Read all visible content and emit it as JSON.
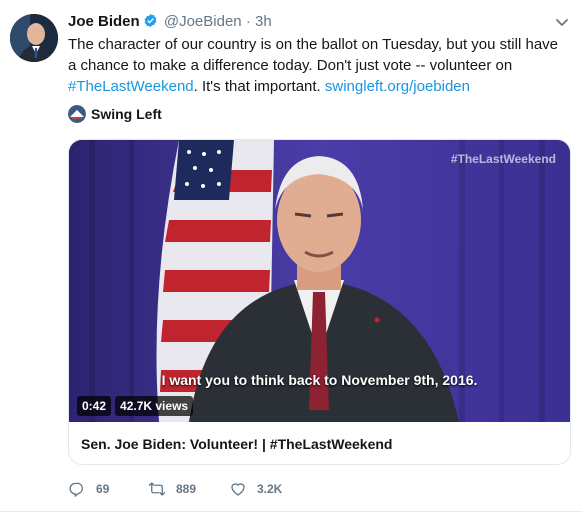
{
  "tweet": {
    "author_name": "Joe Biden",
    "handle": "@JoeBiden",
    "separator": "·",
    "time": "3h",
    "text_part1": "The character of our country is on the ballot on Tuesday, but you still have a chance to make a difference today. Don't just vote -- volunteer on ",
    "hashtag": "#TheLastWeekend",
    "text_part2": ". It's that important. ",
    "link": "swingleft.org/joebiden"
  },
  "source": {
    "name": "Swing Left"
  },
  "video": {
    "hashtag_overlay": "#TheLastWeekend",
    "subtitle": "I want you to think back to November 9th, 2016.",
    "duration": "0:42",
    "views": "42.7K views"
  },
  "card": {
    "title": "Sen. Joe Biden: Volunteer! | #TheLastWeekend"
  },
  "actions": {
    "replies": "69",
    "retweets": "889",
    "likes": "3.2K"
  },
  "colors": {
    "link": "#1b95e0",
    "muted": "#657786",
    "verified": "#1da1f2"
  }
}
